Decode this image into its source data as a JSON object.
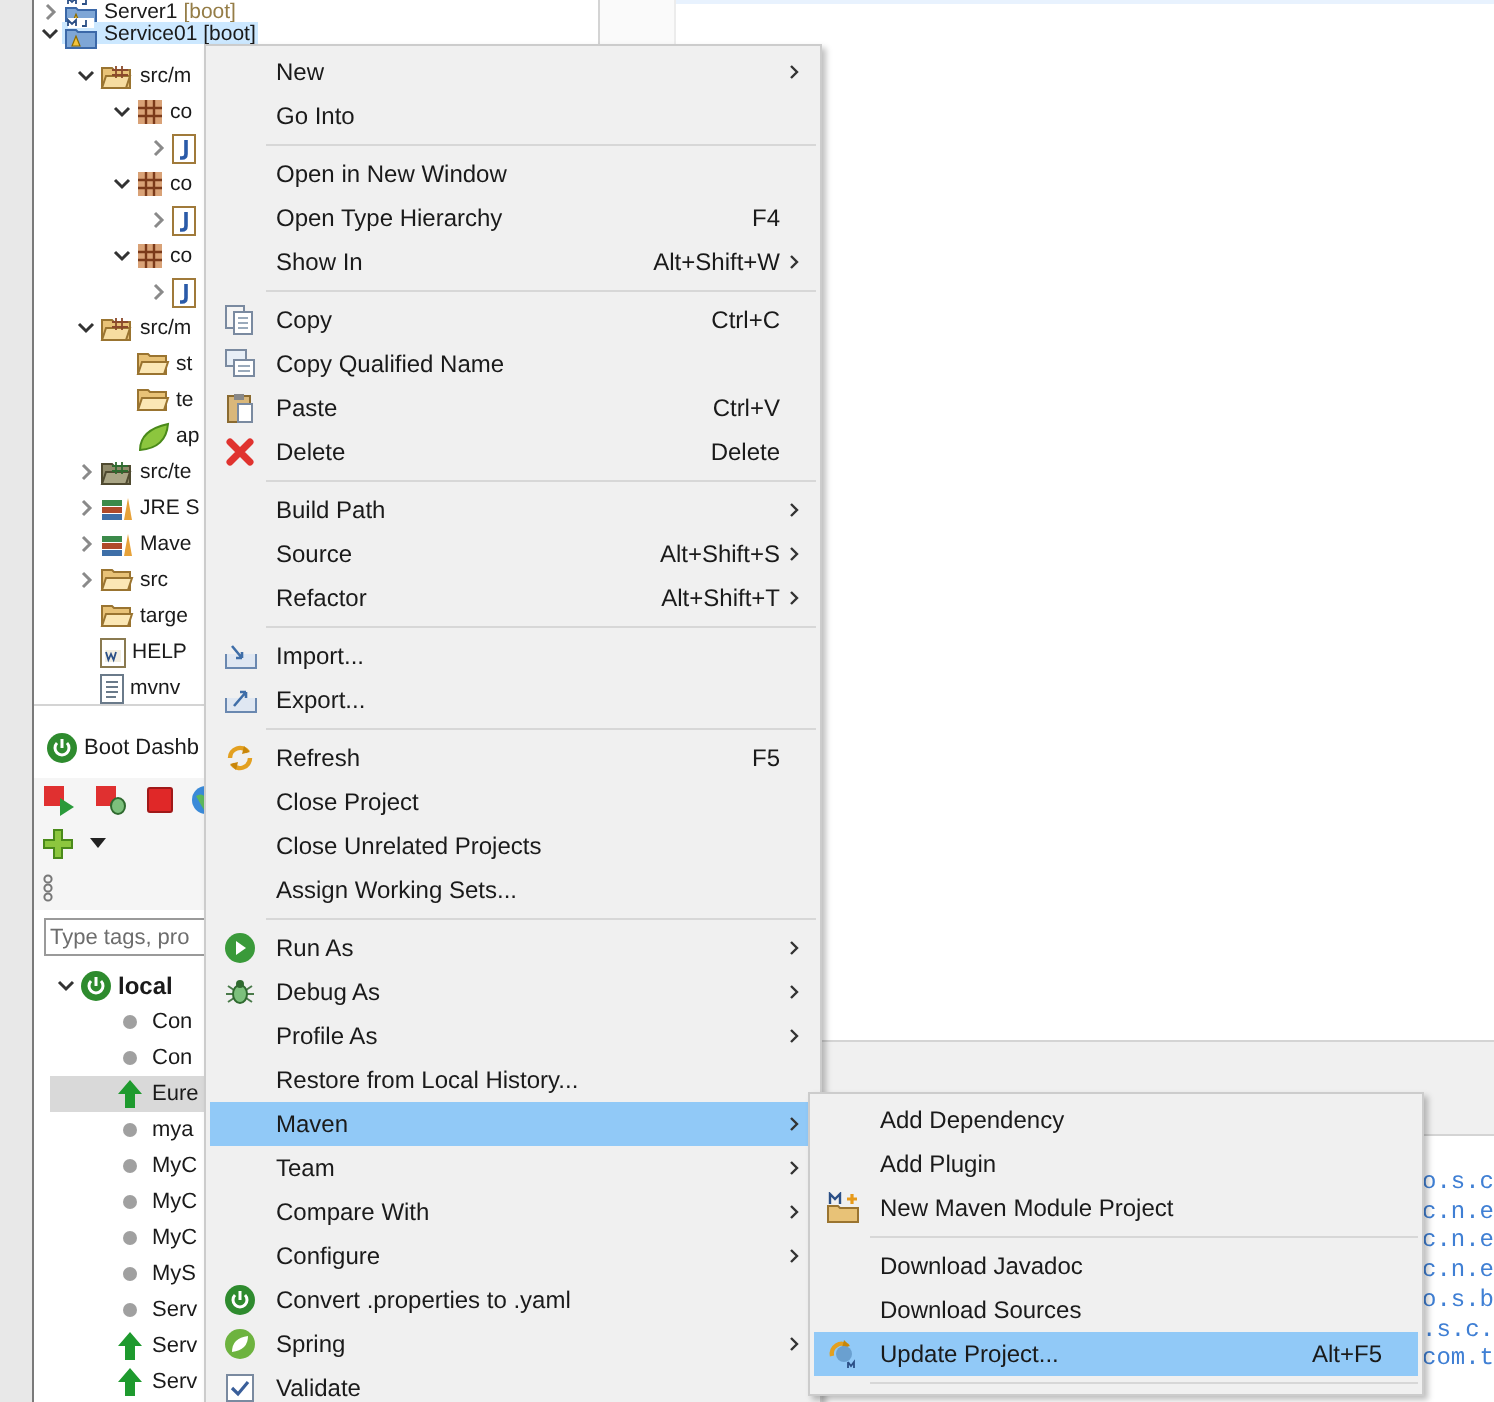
{
  "explorer": {
    "items": [
      {
        "kind": "project",
        "label": "Server1",
        "decoration": "[boot]",
        "expanded": false,
        "selected": false
      },
      {
        "kind": "project",
        "label": "Service01",
        "decoration": "[boot]",
        "expanded": true,
        "selected": true,
        "children": [
          {
            "kind": "source-folder",
            "label": "src/m",
            "expanded": true,
            "selected": false,
            "children": [
              {
                "kind": "package",
                "label": "co",
                "expanded": true,
                "selected": false,
                "children": [
                  {
                    "kind": "java-file",
                    "expanded": false,
                    "selected": false
                  }
                ]
              },
              {
                "kind": "package",
                "label": "co",
                "expanded": true,
                "selected": false,
                "children": [
                  {
                    "kind": "java-file",
                    "expanded": false,
                    "selected": false
                  }
                ]
              },
              {
                "kind": "package",
                "label": "co",
                "expanded": true,
                "selected": false,
                "children": [
                  {
                    "kind": "java-file",
                    "expanded": false,
                    "selected": false
                  }
                ]
              }
            ]
          },
          {
            "kind": "source-folder",
            "label": "src/m",
            "expanded": true,
            "selected": false,
            "children": [
              {
                "kind": "folder",
                "label": "st",
                "selected": false
              },
              {
                "kind": "folder",
                "label": "te",
                "selected": false
              },
              {
                "kind": "spring-file",
                "label": "ap",
                "selected": false
              }
            ]
          },
          {
            "kind": "test-folder",
            "label": "src/te",
            "expanded": false,
            "selected": false
          },
          {
            "kind": "library",
            "label": "JRE S",
            "expanded": false,
            "selected": false
          },
          {
            "kind": "library",
            "label": "Mave",
            "expanded": false,
            "selected": false
          },
          {
            "kind": "folder",
            "label": "src",
            "expanded": false,
            "selected": false
          },
          {
            "kind": "folder",
            "label": "targe",
            "selected": false
          },
          {
            "kind": "word-file",
            "label": "HELP",
            "selected": false
          },
          {
            "kind": "text-file",
            "label": "mvnv",
            "selected": false
          }
        ]
      }
    ]
  },
  "boot_dashboard": {
    "title": "Boot Dashb",
    "search": {
      "placeholder": "Type tags, pro"
    },
    "targets": [
      {
        "label": "local",
        "expanded": true,
        "apps": [
          {
            "label": "Con",
            "running": false,
            "selected": false
          },
          {
            "label": "Con",
            "running": false,
            "selected": false
          },
          {
            "label": "Eure",
            "running": true,
            "selected": true
          },
          {
            "label": "mya",
            "running": false,
            "selected": false
          },
          {
            "label": "MyC",
            "running": false,
            "selected": false
          },
          {
            "label": "MyC",
            "running": false,
            "selected": false
          },
          {
            "label": "MyC",
            "running": false,
            "selected": false
          },
          {
            "label": "MyS",
            "running": false,
            "selected": false
          },
          {
            "label": "Serv",
            "running": false,
            "selected": false
          },
          {
            "label": "Serv",
            "running": true,
            "selected": false
          },
          {
            "label": "Serv",
            "running": true,
            "selected": false
          }
        ]
      }
    ]
  },
  "console": {
    "lines": [
      "o.s.c",
      "c.n.e",
      "c.n.e",
      "c.n.e",
      "o.s.b",
      ".s.c.",
      "com.t"
    ]
  },
  "context_menu": {
    "items": [
      {
        "kind": "item",
        "label": "New",
        "submenu": true,
        "selected": false
      },
      {
        "kind": "item",
        "label": "Go Into",
        "selected": false
      },
      {
        "kind": "separator"
      },
      {
        "kind": "item",
        "label": "Open in New Window",
        "selected": false
      },
      {
        "kind": "item",
        "label": "Open Type Hierarchy",
        "shortcut": "F4",
        "selected": false
      },
      {
        "kind": "item",
        "label": "Show In",
        "shortcut": "Alt+Shift+W",
        "submenu": true,
        "selected": false
      },
      {
        "kind": "separator"
      },
      {
        "kind": "item",
        "label": "Copy",
        "shortcut": "Ctrl+C",
        "selected": false
      },
      {
        "kind": "item",
        "label": "Copy Qualified Name",
        "selected": false
      },
      {
        "kind": "item",
        "label": "Paste",
        "shortcut": "Ctrl+V",
        "selected": false
      },
      {
        "kind": "item",
        "label": "Delete",
        "shortcut": "Delete",
        "selected": false
      },
      {
        "kind": "separator"
      },
      {
        "kind": "item",
        "label": "Build Path",
        "submenu": true,
        "selected": false
      },
      {
        "kind": "item",
        "label": "Source",
        "shortcut": "Alt+Shift+S",
        "submenu": true,
        "selected": false
      },
      {
        "kind": "item",
        "label": "Refactor",
        "shortcut": "Alt+Shift+T",
        "submenu": true,
        "selected": false
      },
      {
        "kind": "separator"
      },
      {
        "kind": "item",
        "label": "Import...",
        "selected": false
      },
      {
        "kind": "item",
        "label": "Export...",
        "selected": false
      },
      {
        "kind": "separator"
      },
      {
        "kind": "item",
        "label": "Refresh",
        "shortcut": "F5",
        "selected": false
      },
      {
        "kind": "item",
        "label": "Close Project",
        "selected": false
      },
      {
        "kind": "item",
        "label": "Close Unrelated Projects",
        "selected": false
      },
      {
        "kind": "item",
        "label": "Assign Working Sets...",
        "selected": false
      },
      {
        "kind": "separator"
      },
      {
        "kind": "item",
        "label": "Run As",
        "submenu": true,
        "selected": false
      },
      {
        "kind": "item",
        "label": "Debug As",
        "submenu": true,
        "selected": false
      },
      {
        "kind": "item",
        "label": "Profile As",
        "submenu": true,
        "selected": false
      },
      {
        "kind": "item",
        "label": "Restore from Local History...",
        "selected": false
      },
      {
        "kind": "item",
        "label": "Maven",
        "submenu": true,
        "selected": true
      },
      {
        "kind": "item",
        "label": "Team",
        "submenu": true,
        "selected": false
      },
      {
        "kind": "item",
        "label": "Compare With",
        "submenu": true,
        "selected": false
      },
      {
        "kind": "item",
        "label": "Configure",
        "submenu": true,
        "selected": false
      },
      {
        "kind": "item",
        "label": "Convert .properties to .yaml",
        "selected": false
      },
      {
        "kind": "item",
        "label": "Spring",
        "submenu": true,
        "selected": false
      },
      {
        "kind": "item",
        "label": "Validate",
        "selected": false
      }
    ]
  },
  "maven_submenu": {
    "items": [
      {
        "kind": "item",
        "label": "Add Dependency",
        "selected": false
      },
      {
        "kind": "item",
        "label": "Add Plugin",
        "selected": false
      },
      {
        "kind": "item",
        "label": "New Maven Module Project",
        "selected": false
      },
      {
        "kind": "separator"
      },
      {
        "kind": "item",
        "label": "Download Javadoc",
        "selected": false
      },
      {
        "kind": "item",
        "label": "Download Sources",
        "selected": false
      },
      {
        "kind": "item",
        "label": "Update Project...",
        "shortcut": "Alt+F5",
        "selected": true
      },
      {
        "kind": "separator"
      }
    ]
  }
}
